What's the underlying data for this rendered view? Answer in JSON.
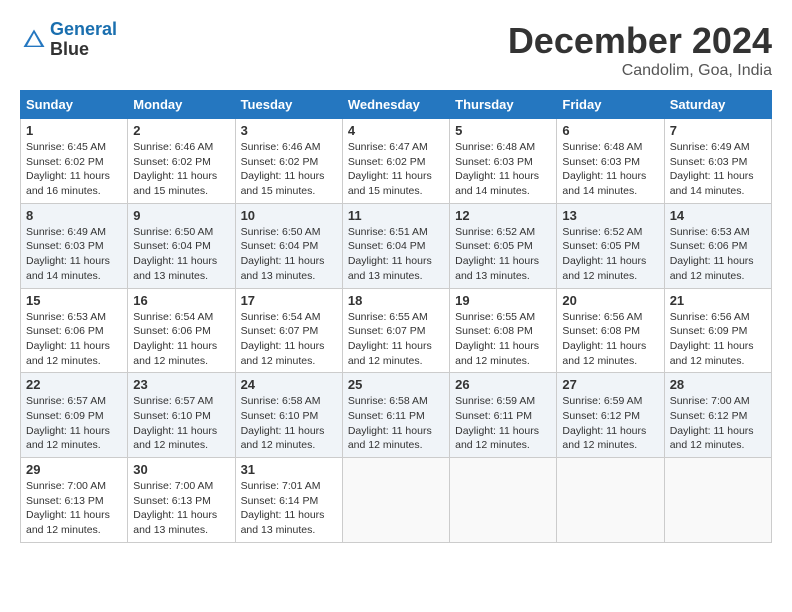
{
  "header": {
    "logo_line1": "General",
    "logo_line2": "Blue",
    "month_year": "December 2024",
    "location": "Candolim, Goa, India"
  },
  "days_of_week": [
    "Sunday",
    "Monday",
    "Tuesday",
    "Wednesday",
    "Thursday",
    "Friday",
    "Saturday"
  ],
  "weeks": [
    [
      {
        "day": "1",
        "info": "Sunrise: 6:45 AM\nSunset: 6:02 PM\nDaylight: 11 hours and 16 minutes."
      },
      {
        "day": "2",
        "info": "Sunrise: 6:46 AM\nSunset: 6:02 PM\nDaylight: 11 hours and 15 minutes."
      },
      {
        "day": "3",
        "info": "Sunrise: 6:46 AM\nSunset: 6:02 PM\nDaylight: 11 hours and 15 minutes."
      },
      {
        "day": "4",
        "info": "Sunrise: 6:47 AM\nSunset: 6:02 PM\nDaylight: 11 hours and 15 minutes."
      },
      {
        "day": "5",
        "info": "Sunrise: 6:48 AM\nSunset: 6:03 PM\nDaylight: 11 hours and 14 minutes."
      },
      {
        "day": "6",
        "info": "Sunrise: 6:48 AM\nSunset: 6:03 PM\nDaylight: 11 hours and 14 minutes."
      },
      {
        "day": "7",
        "info": "Sunrise: 6:49 AM\nSunset: 6:03 PM\nDaylight: 11 hours and 14 minutes."
      }
    ],
    [
      {
        "day": "8",
        "info": "Sunrise: 6:49 AM\nSunset: 6:03 PM\nDaylight: 11 hours and 14 minutes."
      },
      {
        "day": "9",
        "info": "Sunrise: 6:50 AM\nSunset: 6:04 PM\nDaylight: 11 hours and 13 minutes."
      },
      {
        "day": "10",
        "info": "Sunrise: 6:50 AM\nSunset: 6:04 PM\nDaylight: 11 hours and 13 minutes."
      },
      {
        "day": "11",
        "info": "Sunrise: 6:51 AM\nSunset: 6:04 PM\nDaylight: 11 hours and 13 minutes."
      },
      {
        "day": "12",
        "info": "Sunrise: 6:52 AM\nSunset: 6:05 PM\nDaylight: 11 hours and 13 minutes."
      },
      {
        "day": "13",
        "info": "Sunrise: 6:52 AM\nSunset: 6:05 PM\nDaylight: 11 hours and 12 minutes."
      },
      {
        "day": "14",
        "info": "Sunrise: 6:53 AM\nSunset: 6:06 PM\nDaylight: 11 hours and 12 minutes."
      }
    ],
    [
      {
        "day": "15",
        "info": "Sunrise: 6:53 AM\nSunset: 6:06 PM\nDaylight: 11 hours and 12 minutes."
      },
      {
        "day": "16",
        "info": "Sunrise: 6:54 AM\nSunset: 6:06 PM\nDaylight: 11 hours and 12 minutes."
      },
      {
        "day": "17",
        "info": "Sunrise: 6:54 AM\nSunset: 6:07 PM\nDaylight: 11 hours and 12 minutes."
      },
      {
        "day": "18",
        "info": "Sunrise: 6:55 AM\nSunset: 6:07 PM\nDaylight: 11 hours and 12 minutes."
      },
      {
        "day": "19",
        "info": "Sunrise: 6:55 AM\nSunset: 6:08 PM\nDaylight: 11 hours and 12 minutes."
      },
      {
        "day": "20",
        "info": "Sunrise: 6:56 AM\nSunset: 6:08 PM\nDaylight: 11 hours and 12 minutes."
      },
      {
        "day": "21",
        "info": "Sunrise: 6:56 AM\nSunset: 6:09 PM\nDaylight: 11 hours and 12 minutes."
      }
    ],
    [
      {
        "day": "22",
        "info": "Sunrise: 6:57 AM\nSunset: 6:09 PM\nDaylight: 11 hours and 12 minutes."
      },
      {
        "day": "23",
        "info": "Sunrise: 6:57 AM\nSunset: 6:10 PM\nDaylight: 11 hours and 12 minutes."
      },
      {
        "day": "24",
        "info": "Sunrise: 6:58 AM\nSunset: 6:10 PM\nDaylight: 11 hours and 12 minutes."
      },
      {
        "day": "25",
        "info": "Sunrise: 6:58 AM\nSunset: 6:11 PM\nDaylight: 11 hours and 12 minutes."
      },
      {
        "day": "26",
        "info": "Sunrise: 6:59 AM\nSunset: 6:11 PM\nDaylight: 11 hours and 12 minutes."
      },
      {
        "day": "27",
        "info": "Sunrise: 6:59 AM\nSunset: 6:12 PM\nDaylight: 11 hours and 12 minutes."
      },
      {
        "day": "28",
        "info": "Sunrise: 7:00 AM\nSunset: 6:12 PM\nDaylight: 11 hours and 12 minutes."
      }
    ],
    [
      {
        "day": "29",
        "info": "Sunrise: 7:00 AM\nSunset: 6:13 PM\nDaylight: 11 hours and 12 minutes."
      },
      {
        "day": "30",
        "info": "Sunrise: 7:00 AM\nSunset: 6:13 PM\nDaylight: 11 hours and 13 minutes."
      },
      {
        "day": "31",
        "info": "Sunrise: 7:01 AM\nSunset: 6:14 PM\nDaylight: 11 hours and 13 minutes."
      },
      {
        "day": "",
        "info": ""
      },
      {
        "day": "",
        "info": ""
      },
      {
        "day": "",
        "info": ""
      },
      {
        "day": "",
        "info": ""
      }
    ]
  ]
}
